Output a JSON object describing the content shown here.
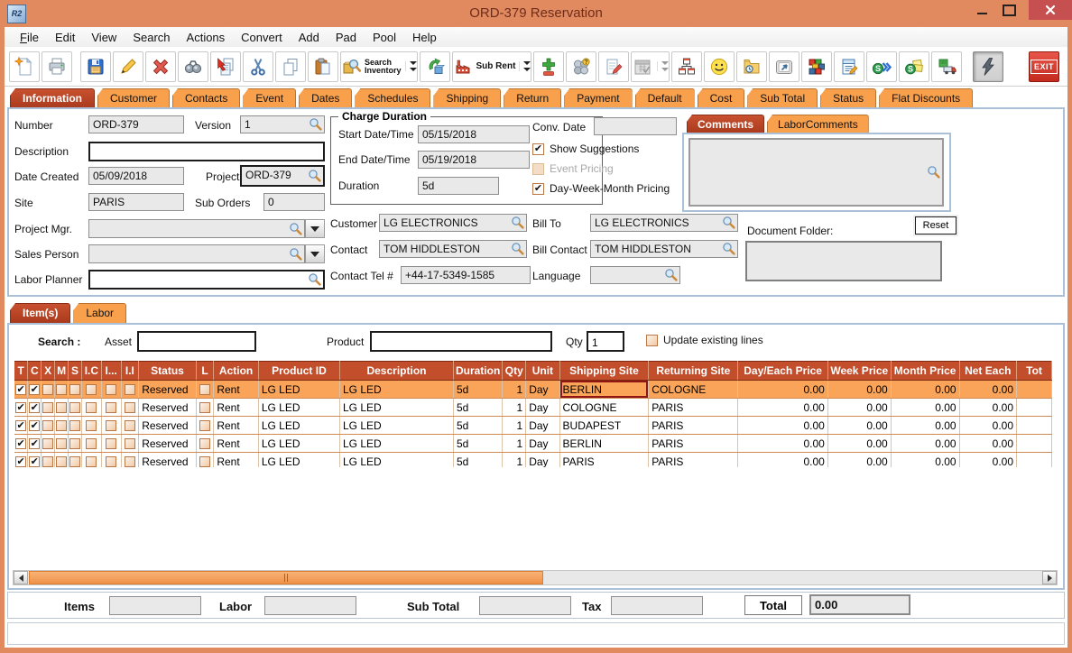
{
  "window": {
    "title": "ORD-379 Reservation",
    "app_icon": "R2"
  },
  "menu": [
    "File",
    "Edit",
    "View",
    "Search",
    "Actions",
    "Convert",
    "Add",
    "Pad",
    "Pool",
    "Help"
  ],
  "toolbar": {
    "search_inventory": "Search\nInventory",
    "sub_rent": "Sub Rent",
    "exit": "EXIT",
    "icons": [
      "new-document",
      "print",
      "save",
      "edit-pencil",
      "delete",
      "find-binoculars",
      "copy-special",
      "cut",
      "copy",
      "paste",
      "search-inventory",
      "convert-product",
      "sub-rent",
      "add-remove-line",
      "group-query",
      "notepad-edit",
      "calendar",
      "site-hierarchy",
      "smiley",
      "folder-time",
      "shortcut-key",
      "inventory-blocks",
      "edit-document",
      "send-forward",
      "send-notes",
      "transfer-truck",
      "quick-action",
      "exit"
    ]
  },
  "tabs": {
    "active": "Information",
    "items": [
      "Information",
      "Customer",
      "Contacts",
      "Event",
      "Dates",
      "Schedules",
      "Shipping",
      "Return",
      "Payment",
      "Default",
      "Cost",
      "Sub Total",
      "Status",
      "Flat Discounts"
    ]
  },
  "form": {
    "number": {
      "label": "Number",
      "value": "ORD-379"
    },
    "version": {
      "label": "Version",
      "value": "1"
    },
    "description": {
      "label": "Description",
      "value": ""
    },
    "date_created": {
      "label": "Date Created",
      "value": "05/09/2018"
    },
    "project": {
      "label": "Project",
      "value": "ORD-379"
    },
    "site": {
      "label": "Site",
      "value": "PARIS"
    },
    "sub_orders": {
      "label": "Sub Orders",
      "value": "0"
    },
    "project_mgr": {
      "label": "Project Mgr.",
      "value": ""
    },
    "sales_person": {
      "label": "Sales Person",
      "value": ""
    },
    "labor_planner": {
      "label": "Labor Planner",
      "value": ""
    },
    "charge_duration": {
      "title": "Charge Duration",
      "start": {
        "label": "Start Date/Time",
        "value": "05/15/2018"
      },
      "end": {
        "label": "End Date/Time",
        "value": "05/19/2018"
      },
      "duration": {
        "label": "Duration",
        "value": "5d"
      }
    },
    "conv_date": {
      "label": "Conv. Date",
      "value": ""
    },
    "options": [
      {
        "label": "Show Suggestions",
        "checked": true,
        "disabled": false
      },
      {
        "label": "Event Pricing",
        "checked": false,
        "disabled": true
      },
      {
        "label": "Day-Week-Month Pricing",
        "checked": true,
        "disabled": false
      }
    ],
    "customer": {
      "label": "Customer",
      "value": "LG ELECTRONICS"
    },
    "bill_to": {
      "label": "Bill To",
      "value": "LG ELECTRONICS"
    },
    "contact": {
      "label": "Contact",
      "value": "TOM HIDDLESTON"
    },
    "bill_contact": {
      "label": "Bill Contact",
      "value": "TOM HIDDLESTON"
    },
    "contact_tel": {
      "label": "Contact Tel #",
      "value": "+44-17-5349-1585"
    },
    "language": {
      "label": "Language",
      "value": ""
    },
    "comments_tabs": {
      "active": "Comments",
      "items": [
        "Comments",
        "LaborComments"
      ]
    },
    "comments_value": "",
    "document_folder": {
      "label": "Document Folder:",
      "reset": "Reset",
      "value": ""
    }
  },
  "items_section": {
    "tabs": {
      "active": "Item(s)",
      "items": [
        "Item(s)",
        "Labor"
      ]
    },
    "search": {
      "label": "Search :",
      "asset_label": "Asset",
      "asset_value": "",
      "product_label": "Product",
      "product_value": "",
      "qty_label": "Qty",
      "qty_value": "1",
      "update_label": "Update existing lines",
      "update_checked": false
    },
    "grid": {
      "columns": [
        {
          "key": "t",
          "label": "T",
          "type": "check"
        },
        {
          "key": "c",
          "label": "C",
          "type": "check"
        },
        {
          "key": "x",
          "label": "X",
          "type": "check"
        },
        {
          "key": "m",
          "label": "M",
          "type": "check"
        },
        {
          "key": "s",
          "label": "S",
          "type": "check"
        },
        {
          "key": "ic",
          "label": "I.C",
          "type": "check"
        },
        {
          "key": "i2",
          "label": "I...",
          "type": "check"
        },
        {
          "key": "ii",
          "label": "I.I",
          "type": "check"
        },
        {
          "key": "status",
          "label": "Status"
        },
        {
          "key": "l",
          "label": "L",
          "type": "check"
        },
        {
          "key": "action",
          "label": "Action"
        },
        {
          "key": "product_id",
          "label": "Product ID"
        },
        {
          "key": "description",
          "label": "Description"
        },
        {
          "key": "duration",
          "label": "Duration"
        },
        {
          "key": "qty",
          "label": "Qty",
          "align": "right"
        },
        {
          "key": "unit",
          "label": "Unit"
        },
        {
          "key": "shipping_site",
          "label": "Shipping Site"
        },
        {
          "key": "returning_site",
          "label": "Returning Site"
        },
        {
          "key": "day_each_price",
          "label": "Day/Each Price",
          "align": "right"
        },
        {
          "key": "week_price",
          "label": "Week Price",
          "align": "right"
        },
        {
          "key": "month_price",
          "label": "Month Price",
          "align": "right"
        },
        {
          "key": "net_each",
          "label": "Net Each",
          "align": "right"
        },
        {
          "key": "tot",
          "label": "Tot",
          "align": "right"
        }
      ],
      "rows": [
        {
          "t": true,
          "c": true,
          "x": false,
          "m": false,
          "s": false,
          "ic": false,
          "i2": false,
          "ii": false,
          "status": "Reserved",
          "l": false,
          "action": "Rent",
          "product_id": "LG LED",
          "description": "LG LED",
          "duration": "5d",
          "qty": "1",
          "unit": "Day",
          "shipping_site": "BERLIN",
          "returning_site": "COLOGNE",
          "day_each_price": "0.00",
          "week_price": "0.00",
          "month_price": "0.00",
          "net_each": "0.00",
          "tot": ""
        },
        {
          "t": true,
          "c": true,
          "x": false,
          "m": false,
          "s": false,
          "ic": false,
          "i2": false,
          "ii": false,
          "status": "Reserved",
          "l": false,
          "action": "Rent",
          "product_id": "LG LED",
          "description": "LG LED",
          "duration": "5d",
          "qty": "1",
          "unit": "Day",
          "shipping_site": "COLOGNE",
          "returning_site": "PARIS",
          "day_each_price": "0.00",
          "week_price": "0.00",
          "month_price": "0.00",
          "net_each": "0.00",
          "tot": ""
        },
        {
          "t": true,
          "c": true,
          "x": false,
          "m": false,
          "s": false,
          "ic": false,
          "i2": false,
          "ii": false,
          "status": "Reserved",
          "l": false,
          "action": "Rent",
          "product_id": "LG LED",
          "description": "LG LED",
          "duration": "5d",
          "qty": "1",
          "unit": "Day",
          "shipping_site": "BUDAPEST",
          "returning_site": "PARIS",
          "day_each_price": "0.00",
          "week_price": "0.00",
          "month_price": "0.00",
          "net_each": "0.00",
          "tot": ""
        },
        {
          "t": true,
          "c": true,
          "x": false,
          "m": false,
          "s": false,
          "ic": false,
          "i2": false,
          "ii": false,
          "status": "Reserved",
          "l": false,
          "action": "Rent",
          "product_id": "LG LED",
          "description": "LG LED",
          "duration": "5d",
          "qty": "1",
          "unit": "Day",
          "shipping_site": "BERLIN",
          "returning_site": "PARIS",
          "day_each_price": "0.00",
          "week_price": "0.00",
          "month_price": "0.00",
          "net_each": "0.00",
          "tot": ""
        },
        {
          "t": true,
          "c": true,
          "x": false,
          "m": false,
          "s": false,
          "ic": false,
          "i2": false,
          "ii": false,
          "status": "Reserved",
          "l": false,
          "action": "Rent",
          "product_id": "LG LED",
          "description": "LG LED",
          "duration": "5d",
          "qty": "1",
          "unit": "Day",
          "shipping_site": "PARIS",
          "returning_site": "PARIS",
          "day_each_price": "0.00",
          "week_price": "0.00",
          "month_price": "0.00",
          "net_each": "0.00",
          "tot": ""
        }
      ],
      "selected_row": 0,
      "focused_cell": "shipping_site"
    }
  },
  "summary": {
    "items_label": "Items",
    "items_value": "",
    "labor_label": "Labor",
    "labor_value": "",
    "sub_total_label": "Sub Total",
    "sub_total_value": "",
    "tax_label": "Tax",
    "tax_value": "",
    "total_label": "Total",
    "total_value": "0.00"
  },
  "colors": {
    "window_orange": "#E18A5F",
    "tab_orange": "#F9A04D",
    "active_tab_red": "#BC4526",
    "grid_header_red": "#C24E2C",
    "selected_row": "#F9A458",
    "close_button_red": "#C65050",
    "panel_border_blue": "#A9C0D8"
  }
}
